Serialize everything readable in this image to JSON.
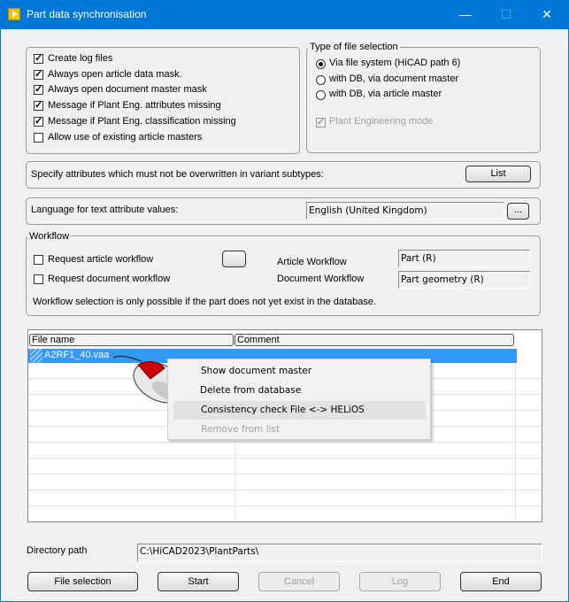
{
  "window": {
    "title": "Part data synchronisation",
    "minimize": "—",
    "maximize": "☐",
    "close": "✕"
  },
  "options": {
    "items": [
      {
        "label": "Create log files",
        "checked": true
      },
      {
        "label": "Always open article data mask.",
        "checked": true
      },
      {
        "label": "Always open document master mask",
        "checked": true
      },
      {
        "label": "Message if Plant Eng. attributes missing",
        "checked": true
      },
      {
        "label": "Message if Plant Eng. classification missing",
        "checked": true
      },
      {
        "label": "Allow use of existing article masters",
        "checked": false
      }
    ]
  },
  "file_selection_type": {
    "legend": "Type of file selection",
    "options": [
      {
        "label": "Via file system (HiCAD path 6)",
        "selected": true
      },
      {
        "label": "with DB, via document master",
        "selected": false
      },
      {
        "label": "with DB, via article master",
        "selected": false
      }
    ],
    "plant_engineering_mode": "Plant Engineering mode"
  },
  "attributes": {
    "label": "Specify attributes which must not be overwritten in variant subtypes:",
    "list_button": "List"
  },
  "language": {
    "label": "Language for text attribute values:",
    "value": "English (United Kingdom)",
    "browse_button": "..."
  },
  "workflow": {
    "legend": "Workflow",
    "request_article": "Request article workflow",
    "request_document": "Request document workflow",
    "article_workflow_label": "Article Workflow",
    "article_workflow_value": "Part (R)",
    "document_workflow_label": "Document Workflow",
    "document_workflow_value": "Part geometry (R)",
    "note": "Workflow selection is only possible if the part does not yet exist in the database."
  },
  "file_list": {
    "columns": [
      "File name",
      "Comment"
    ],
    "rows": [
      {
        "file": "A2RF1_40.vaa",
        "comment": ""
      }
    ]
  },
  "context_menu": {
    "items": [
      {
        "label": "Show document master",
        "enabled": true
      },
      {
        "label": "Delete from database",
        "enabled": true
      },
      {
        "label": "Consistency check File <-> HELiOS",
        "enabled": true
      },
      {
        "label": "Remove from list",
        "enabled": false
      }
    ]
  },
  "directory": {
    "label": "Directory path",
    "value": "C:\\HiCAD2023\\PlantParts\\"
  },
  "buttons": {
    "file_selection": "File selection",
    "start": "Start",
    "cancel": "Cancel",
    "log": "Log",
    "end": "End"
  },
  "colors": {
    "titlebar": "#0078d7",
    "selection": "#3399ff",
    "accent_mouse": "#cc0000"
  }
}
